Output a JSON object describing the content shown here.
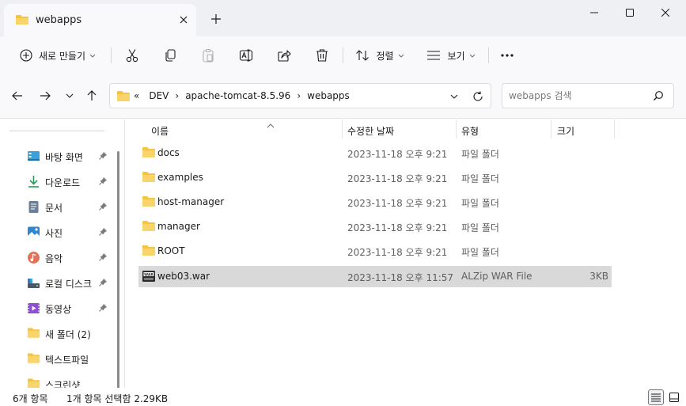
{
  "window": {
    "tab_title": "webapps",
    "colors": {
      "folder": "#f6c343",
      "accent": "#0067c0",
      "selection": "#d9d9d9"
    }
  },
  "toolbar": {
    "new_label": "새로 만들기",
    "sort_label": "정렬",
    "view_label": "보기",
    "icons": [
      "cut-icon",
      "copy-icon",
      "paste-icon",
      "rename-icon",
      "share-icon",
      "delete-icon",
      "more-icon"
    ]
  },
  "address": {
    "overflow": "«",
    "crumbs": [
      "DEV",
      "apache-tomcat-8.5.96",
      "webapps"
    ]
  },
  "search": {
    "placeholder": "webapps 검색"
  },
  "sidebar": {
    "items": [
      {
        "label": "바탕 화면",
        "icon": "desktop-icon",
        "pinned": true
      },
      {
        "label": "다운로드",
        "icon": "download-icon",
        "pinned": true
      },
      {
        "label": "문서",
        "icon": "document-icon",
        "pinned": true
      },
      {
        "label": "사진",
        "icon": "pictures-icon",
        "pinned": true
      },
      {
        "label": "음악",
        "icon": "music-icon",
        "pinned": true
      },
      {
        "label": "로컬 디스크",
        "icon": "drive-icon",
        "pinned": true
      },
      {
        "label": "동영상",
        "icon": "video-icon",
        "pinned": true
      },
      {
        "label": "새 폴더 (2)",
        "icon": "folder-icon",
        "pinned": false
      },
      {
        "label": "텍스트파일",
        "icon": "folder-icon",
        "pinned": false
      },
      {
        "label": "스크린샷",
        "icon": "folder-icon",
        "pinned": false
      }
    ]
  },
  "columns": {
    "name": "이름",
    "modified": "수정한 날짜",
    "type": "유형",
    "size": "크기"
  },
  "files": [
    {
      "name": "docs",
      "modified": "2023-11-18 오후 9:21",
      "type": "파일 폴더",
      "size": "",
      "icon": "folder-icon",
      "selected": false
    },
    {
      "name": "examples",
      "modified": "2023-11-18 오후 9:21",
      "type": "파일 폴더",
      "size": "",
      "icon": "folder-icon",
      "selected": false
    },
    {
      "name": "host-manager",
      "modified": "2023-11-18 오후 9:21",
      "type": "파일 폴더",
      "size": "",
      "icon": "folder-icon",
      "selected": false
    },
    {
      "name": "manager",
      "modified": "2023-11-18 오후 9:21",
      "type": "파일 폴더",
      "size": "",
      "icon": "folder-icon",
      "selected": false
    },
    {
      "name": "ROOT",
      "modified": "2023-11-18 오후 9:21",
      "type": "파일 폴더",
      "size": "",
      "icon": "folder-icon",
      "selected": false
    },
    {
      "name": "web03.war",
      "modified": "2023-11-18 오후 11:57",
      "type": "ALZip WAR File",
      "size": "3KB",
      "icon": "war-file-icon",
      "selected": true
    }
  ],
  "status": {
    "item_count": "6개 항목",
    "selection": "1개 항목 선택함 2.29KB"
  }
}
